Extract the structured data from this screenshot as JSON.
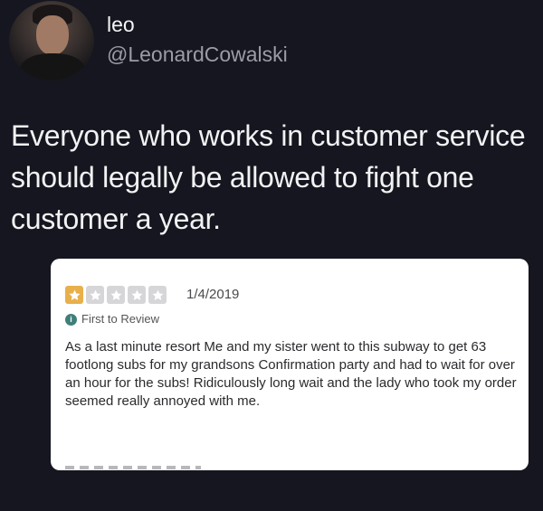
{
  "tweet": {
    "display_name": "leo",
    "handle": "@LeonardCowalski",
    "text": "Everyone who works in customer service should legally be allowed to fight one customer a year."
  },
  "review": {
    "rating": 1,
    "rating_max": 5,
    "date": "1/4/2019",
    "badge_icon": "i",
    "badge": "First to Review",
    "text": "As a last minute resort Me and my sister went to this subway to get 63 footlong subs for my grandsons Confirmation party and had to wait for over an hour for the subs! Ridiculously long wait and the lady who took my order seemed really annoyed with me."
  },
  "colors": {
    "background": "#15161f",
    "star_on": "#e8b04a",
    "star_off": "#d6d6d8",
    "badge": "#3f7f7a"
  },
  "icons": {
    "star": "star-icon",
    "badge": "info-badge-icon"
  }
}
